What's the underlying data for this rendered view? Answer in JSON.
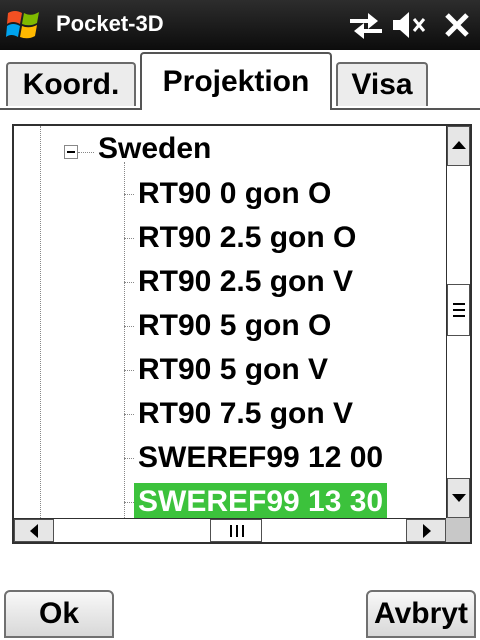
{
  "window": {
    "title": "Pocket-3D"
  },
  "tabs": [
    {
      "label": "Koord."
    },
    {
      "label": "Projektion"
    },
    {
      "label": "Visa"
    }
  ],
  "tree": {
    "group_label": "Sweden",
    "items": [
      {
        "label": "RT90 0 gon O"
      },
      {
        "label": "RT90 2.5 gon O"
      },
      {
        "label": "RT90 2.5 gon V"
      },
      {
        "label": "RT90 5 gon O"
      },
      {
        "label": "RT90 5 gon V"
      },
      {
        "label": "RT90 7.5 gon V"
      },
      {
        "label": "SWEREF99 12 00"
      },
      {
        "label": "SWEREF99 13 30"
      }
    ],
    "selected_item": "SWEREF99 13 30"
  },
  "softkeys": {
    "ok_label": "Ok",
    "cancel_label": "Avbryt"
  },
  "icons": {
    "start": "windows-flag-icon",
    "connectivity": "connectivity-arrows-icon",
    "volume": "volume-muted-icon",
    "close": "close-icon"
  },
  "colors": {
    "selection": "#3cc23c",
    "titlebar": "#111111"
  }
}
